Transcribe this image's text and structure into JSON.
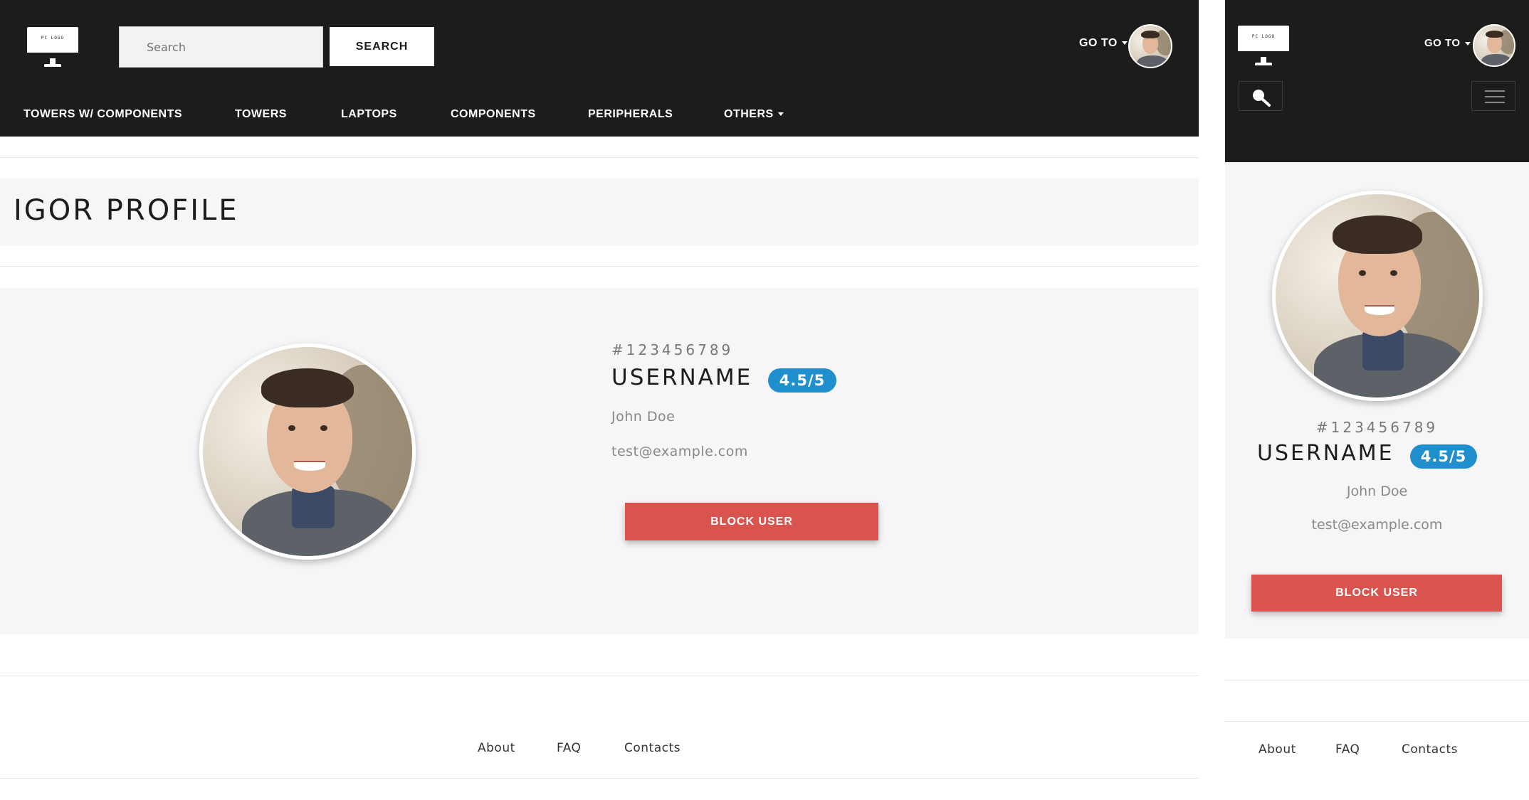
{
  "desktop": {
    "header": {
      "search_placeholder": "Search",
      "search_button": "SEARCH",
      "goto_label": "GO TO",
      "logo_text": "PC LOGO"
    },
    "nav": [
      {
        "label": "TOWERS W/ COMPONENTS"
      },
      {
        "label": "TOWERS"
      },
      {
        "label": "LAPTOPS"
      },
      {
        "label": "COMPONENTS"
      },
      {
        "label": "PERIPHERALS"
      },
      {
        "label": "OTHERS"
      }
    ],
    "page_title": "IGOR PROFILE",
    "profile": {
      "id": "#123456789",
      "username": "USERNAME",
      "rating": "4.5/5",
      "name": "John Doe",
      "email": "test@example.com",
      "block_button": "BLOCK USER"
    },
    "footer": {
      "about": "About",
      "faq": "FAQ",
      "contacts": "Contacts"
    }
  },
  "mobile": {
    "header": {
      "goto_label": "GO TO",
      "logo_text": "PC LOGO"
    },
    "profile": {
      "id": "#123456789",
      "username": "USERNAME",
      "rating": "4.5/5",
      "name": "John Doe",
      "email": "test@example.com",
      "block_button": "BLOCK USER"
    },
    "footer": {
      "about": "About",
      "faq": "FAQ",
      "contacts": "Contacts"
    }
  },
  "colors": {
    "header_bg": "#1c1c1b",
    "panel_bg": "#f6f6f8",
    "accent_badge": "#1f8fce",
    "danger": "#d9534f"
  }
}
